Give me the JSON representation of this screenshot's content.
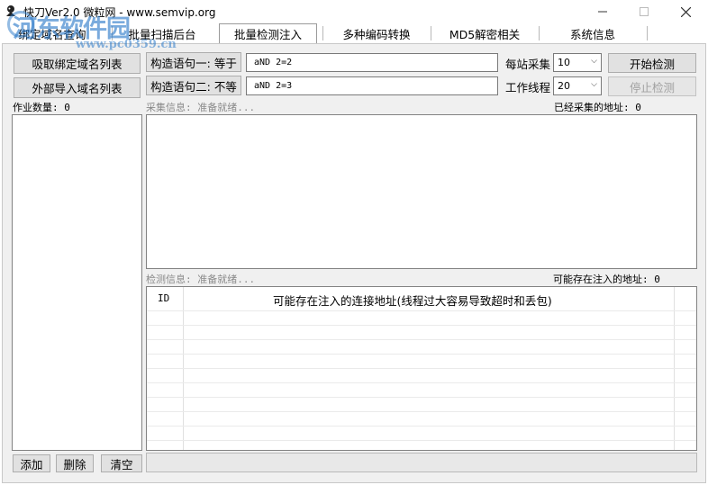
{
  "window": {
    "title": "快刀Ver2.0   微粒网 - www.semvip.org",
    "watermark": "河东软件园",
    "watermark_url": "www.pc0359.cn"
  },
  "tabs": [
    {
      "label": "绑定域名查询"
    },
    {
      "label": "批量扫描后台"
    },
    {
      "label": "批量检测注入"
    },
    {
      "label": "多种编码转换"
    },
    {
      "label": "MD5解密相关"
    },
    {
      "label": "系统信息"
    }
  ],
  "left": {
    "fetch_button": "吸取绑定域名列表",
    "import_button": "外部导入域名列表",
    "job_count_label": "作业数量: 0",
    "add_button": "添加",
    "delete_button": "删除",
    "clear_button": "清空"
  },
  "query": {
    "stmt1_label": "构造语句一: 等于",
    "stmt1_value": "aND 2=2",
    "stmt2_label": "构造语句二: 不等",
    "stmt2_value": "aND 2=3",
    "per_site_label": "每站采集",
    "per_site_value": "10",
    "threads_label": "工作线程",
    "threads_value": "20",
    "start_button": "开始检测",
    "stop_button": "停止检测"
  },
  "collect": {
    "status": "采集信息: 准备就绪...",
    "count": "已经采集的地址: 0"
  },
  "detect": {
    "status": "检测信息: 准备就绪...",
    "count": "可能存在注入的地址: 0",
    "col_id": "ID",
    "col_url": "可能存在注入的连接地址(线程过大容易导致超时和丢包)"
  }
}
